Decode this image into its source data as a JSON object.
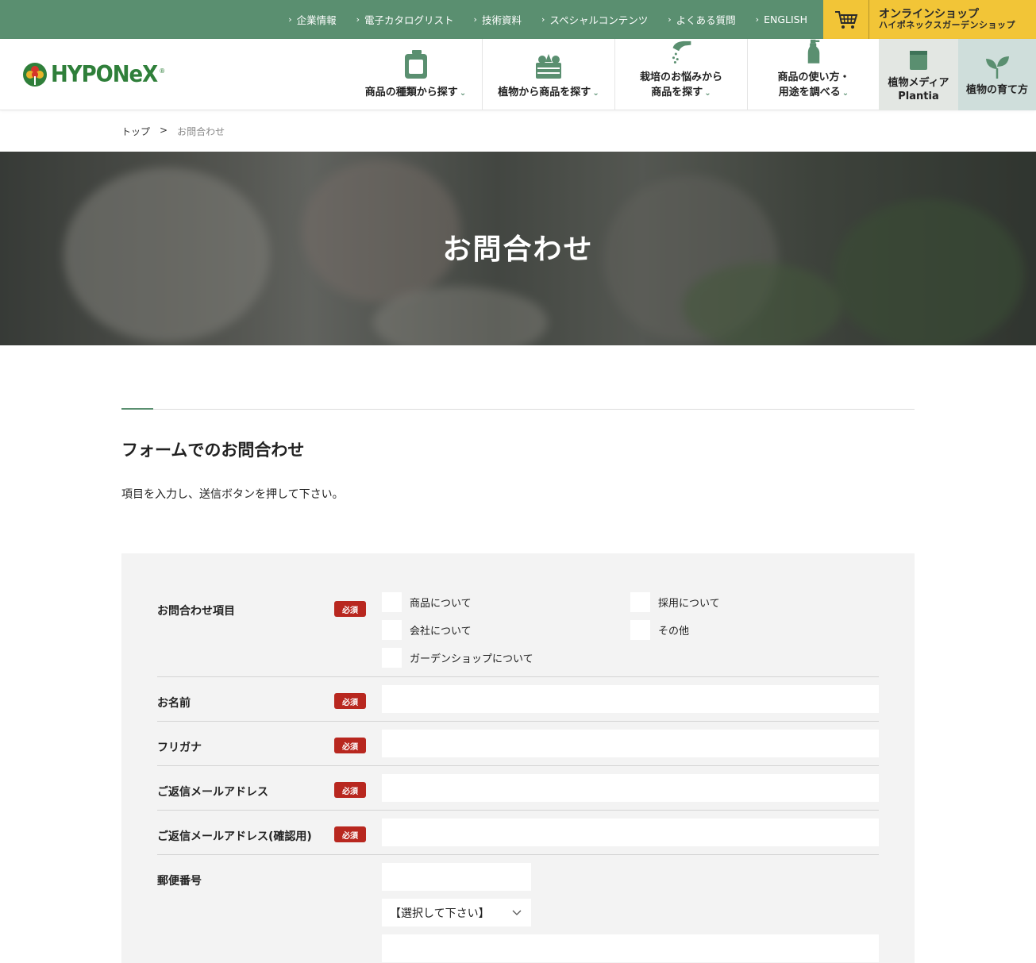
{
  "topbar": {
    "links": [
      "企業情報",
      "電子カタログリスト",
      "技術資料",
      "スペシャルコンテンツ",
      "よくある質問",
      "ENGLISH"
    ],
    "shop_line1": "オンラインショップ",
    "shop_line2": "ハイポネックスガーデンショップ"
  },
  "logo": {
    "text": "HYPONeX",
    "reg": "®"
  },
  "nav": {
    "items": [
      {
        "line1": "商品の種類から探す",
        "line2": ""
      },
      {
        "line1": "植物から商品を探す",
        "line2": ""
      },
      {
        "line1": "栽培のお悩みから",
        "line2": "商品を探す"
      },
      {
        "line1": "商品の使い方・",
        "line2": "用途を調べる"
      }
    ],
    "media_line1": "植物メディア",
    "media_line2": "Plantia",
    "grow": "植物の育て方"
  },
  "breadcrumb": {
    "home": "トップ",
    "sep": ">",
    "current": "お問合わせ"
  },
  "hero": {
    "title": "お問合わせ"
  },
  "section": {
    "title": "フォームでのお問合わせ",
    "lead": "項目を入力し、送信ボタンを押して下さい。"
  },
  "form": {
    "required": "必須",
    "inquiry": {
      "label": "お問合わせ項目",
      "options": [
        "商品について",
        "採用について",
        "会社について",
        "その他",
        "ガーデンショップについて"
      ]
    },
    "name_label": "お名前",
    "kana_label": "フリガナ",
    "email_label": "ご返信メールアドレス",
    "email_confirm_label": "ご返信メールアドレス(確認用)",
    "zip_label": "郵便番号",
    "prefecture_select": "【選択して下さい】"
  },
  "colors": {
    "green": "#5a8f70",
    "yellow": "#f2c537",
    "required_red": "#b8271f"
  }
}
